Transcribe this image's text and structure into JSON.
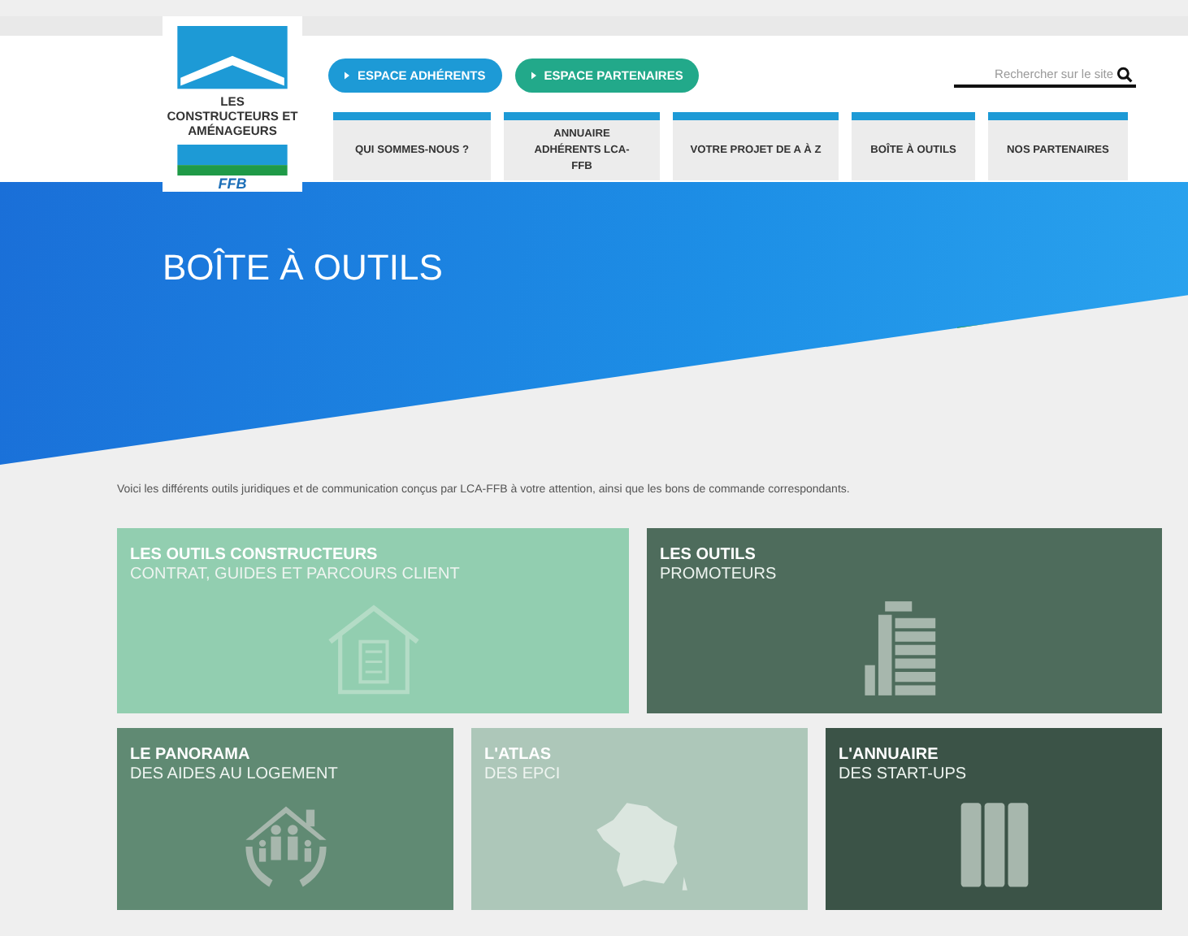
{
  "logo": {
    "name": "LES CONSTRUCTEURS ET AMÉNAGEURS",
    "badge": "FFB"
  },
  "header_buttons": [
    {
      "label": "ESPACE ADHÉRENTS",
      "color": "#1d9ad6"
    },
    {
      "label": "ESPACE PARTENAIRES",
      "color": "#22a98a"
    }
  ],
  "search": {
    "placeholder": "Rechercher sur le site"
  },
  "nav": [
    {
      "label": "QUI SOMMES-NOUS ?",
      "selected": false
    },
    {
      "label": "ANNUAIRE ADHÉRENTS LCA-FFB",
      "selected": false
    },
    {
      "label": "VOTRE PROJET DE A À Z",
      "selected": false
    },
    {
      "label": "BOÎTE À OUTILS",
      "selected": false
    },
    {
      "label": "NOS PARTENAIRES",
      "selected": false
    }
  ],
  "page_title": "BOÎTE À OUTILS",
  "intro": "Voici les différents outils juridiques et de communication conçus par LCA-FFB à votre attention, ainsi que les bons de commande correspondants.",
  "tiles": [
    {
      "title": "LES OUTILS CONSTRUCTEURS",
      "subtitle": "CONTRAT, GUIDES ET PARCOURS CLIENT",
      "color": "#92ceb0",
      "kind": "house"
    },
    {
      "title": "LES OUTILS",
      "subtitle": "PROMOTEURS",
      "color": "#4e6c5c",
      "kind": "building"
    },
    {
      "title": "LE PANORAMA",
      "subtitle": "DES AIDES AU LOGEMENT",
      "color": "#608a73",
      "kind": "family"
    },
    {
      "title": "L'ATLAS",
      "subtitle": "DES EPCI",
      "color": "#adc7b9",
      "kind": "map"
    },
    {
      "title": "L'ANNUAIRE",
      "subtitle": "DES START-UPS",
      "color": "#3b5347",
      "kind": "binders"
    }
  ]
}
